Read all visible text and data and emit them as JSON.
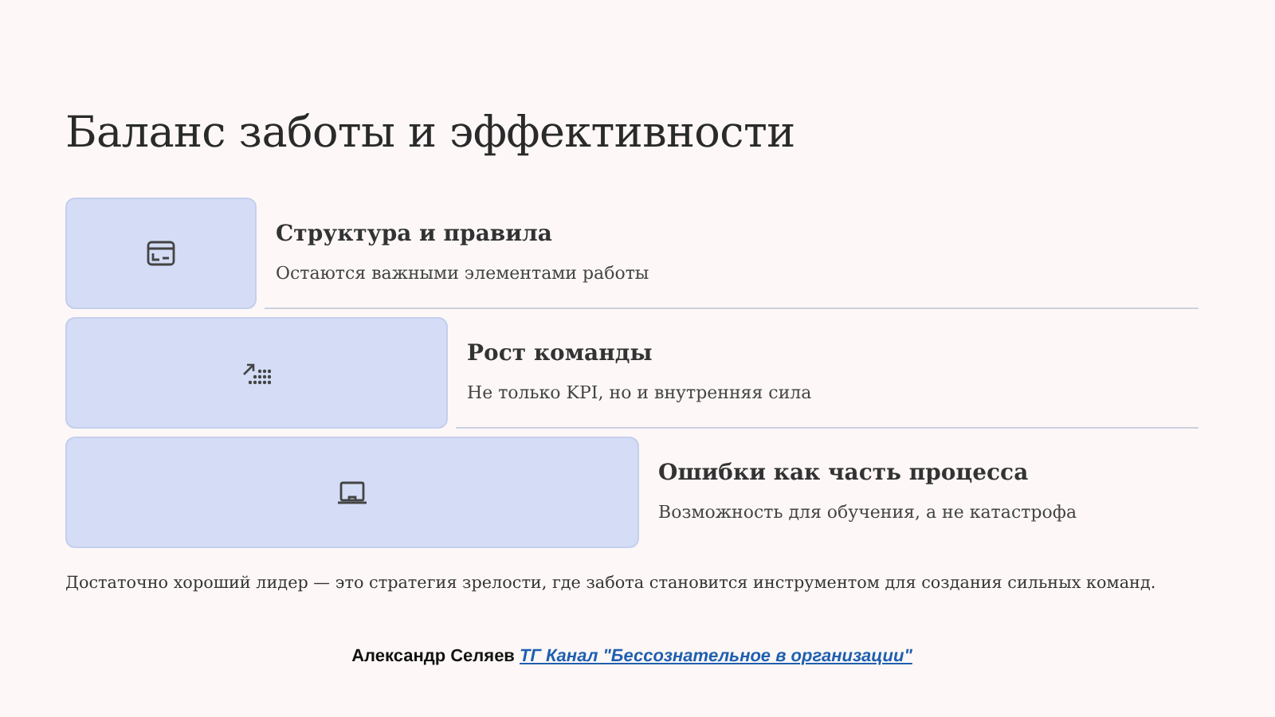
{
  "title": "Баланс заботы и эффективности",
  "steps": [
    {
      "kind": "card",
      "heading": "Структура и правила",
      "text": "Остаются важными элементами работы"
    },
    {
      "kind": "growth",
      "heading": "Рост команды",
      "text": "Не только KPI, но и внутренняя сила"
    },
    {
      "kind": "laptop",
      "heading": "Ошибки как часть процесса",
      "text": "Возможность для обучения, а не катастрофа"
    }
  ],
  "summary": "Достаточно хороший лидер — это стратегия зрелости, где забота становится инструментом для создания сильных команд.",
  "footer": {
    "author": "Александр Селяев",
    "link": "ТГ Канал \"Бессознательное в организации\""
  }
}
